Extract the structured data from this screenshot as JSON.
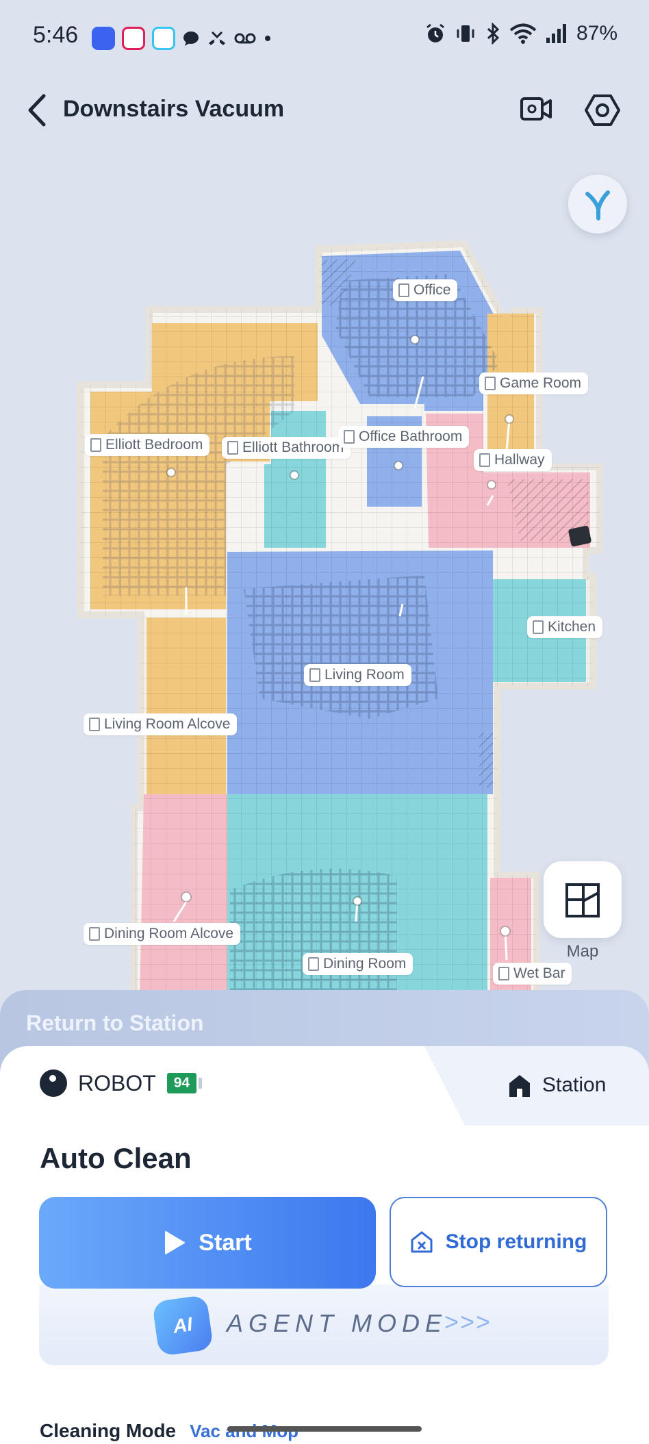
{
  "status_bar": {
    "time": "5:46",
    "battery_percent": "87%",
    "left_icons": [
      "signal-app-icon",
      "slack-icon",
      "slack-icon",
      "chat-icon",
      "missed-call-icon",
      "voicemail-icon",
      "dot-icon"
    ],
    "right_icons": [
      "alarm-icon",
      "vibrate-icon",
      "bluetooth-icon",
      "wifi-icon",
      "cell-signal-icon"
    ]
  },
  "header": {
    "title": "Downstairs Vacuum"
  },
  "map": {
    "rooms": [
      {
        "label": "Office"
      },
      {
        "label": "Game Room"
      },
      {
        "label": "Elliott Bedroom"
      },
      {
        "label": "Elliott Bathroom"
      },
      {
        "label": "Office Bathroom"
      },
      {
        "label": "Hallway"
      },
      {
        "label": "Kitchen"
      },
      {
        "label": "Living Room"
      },
      {
        "label": "Living Room Alcove"
      },
      {
        "label": "Dining Room Alcove"
      },
      {
        "label": "Dining Room"
      },
      {
        "label": "Wet Bar"
      }
    ],
    "colors": {
      "orange": "#f1c77e",
      "blue": "#8fb0ea",
      "teal": "#86d6dc",
      "pink": "#f4bcc6"
    },
    "map_button_label": "Map"
  },
  "return_banner": {
    "text": "Return to Station"
  },
  "device": {
    "robot_label": "ROBOT",
    "battery": "94",
    "station_label": "Station"
  },
  "mode": {
    "title": "Auto Clean",
    "start_label": "Start",
    "stop_label": "Stop returning",
    "agent_badge": "AI",
    "agent_label": "AGENT MODE",
    "agent_arrows": ">>>",
    "cleaning_mode_label": "Cleaning Mode",
    "cleaning_mode_value": "Vac and Mop"
  }
}
